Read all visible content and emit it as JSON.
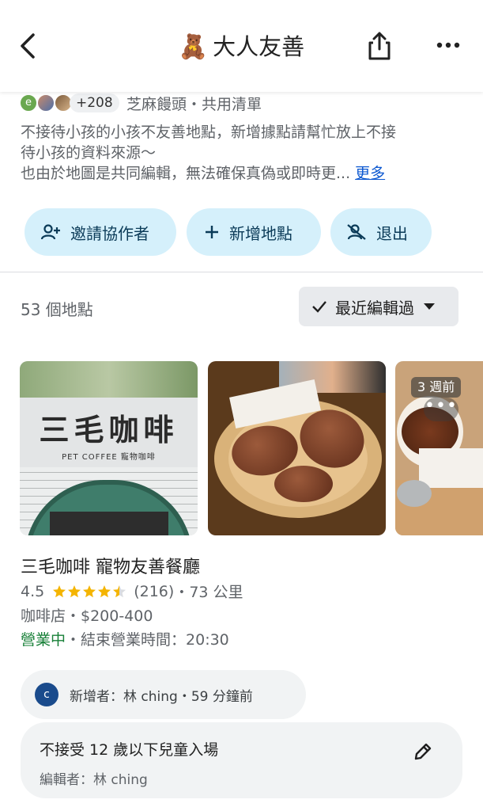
{
  "header": {
    "title": "大人友善",
    "bear_emoji": "🧸"
  },
  "collaborators": {
    "avatar_initial": "e",
    "count": "+208",
    "owner_line": "芝麻饅頭・共用清單"
  },
  "description": {
    "line1": "不接待小孩的小孩不友善地點，新增據點請幫忙放上不接",
    "line2": "待小孩的資料來源～",
    "line3": "也由於地圖是共同編輯，無法確保真偽或即時更...",
    "more": "更多"
  },
  "actions": {
    "invite": "邀請協作者",
    "add_place": "新增地點",
    "exit": "退出"
  },
  "list": {
    "count_label": "53 個地點",
    "sort_label": "最近編輯過"
  },
  "photos": {
    "sign_text": "三毛咖啡",
    "sign_sub": "PET COFFEE 寵物咖啡",
    "time_chip": "3 週前",
    "dots": "•••"
  },
  "place": {
    "name": "三毛咖啡 寵物友善餐廳",
    "rating": "4.5",
    "rating_value": 4.5,
    "reviews": "(216)",
    "distance": "・73 公里",
    "category_price": "咖啡店・$200-400",
    "open_status": "營業中",
    "hours": "・結束營業時間：20:30"
  },
  "added_by": {
    "initial": "c",
    "text": "新增者：林 ching・59 分鐘前"
  },
  "note": {
    "title": "不接受 12 歲以下兒童入場",
    "editor": "編輯者：林 ching"
  },
  "colors": {
    "accent_button_bg": "#d5f0fb",
    "link": "#0b57d0",
    "open_green": "#188038",
    "star": "#f4b400"
  }
}
